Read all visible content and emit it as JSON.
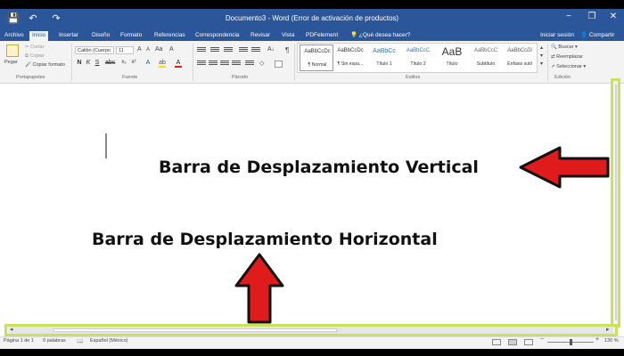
{
  "quick_access": [
    "💾",
    "↶",
    "↷"
  ],
  "window": {
    "title": "Documento3 - Word (Error de activación de productos)",
    "minimize": "−",
    "restore": "❐",
    "close": "✕"
  },
  "tabs": [
    "Archivo",
    "Inicio",
    "Insertar",
    "Diseño",
    "Formato",
    "Referencias",
    "Correspondencia",
    "Revisar",
    "Vista",
    "PDFelement"
  ],
  "active_tab": "Inicio",
  "tell_me": "¿Qué desea hacer?",
  "sign_in": "Iniciar sesión",
  "share": "Compartir",
  "ribbon": {
    "clipboard": {
      "paste": "Pegar",
      "cut": "Cortar",
      "copy": "Copiar",
      "format_painter": "Copiar formato",
      "label": "Portapapeles"
    },
    "font": {
      "name": "Calibri (Cuerpo",
      "size": "11",
      "label": "Fuente"
    },
    "paragraph": {
      "label": "Párrafo"
    },
    "styles": {
      "label": "Estilos",
      "items": [
        {
          "sample": "AaBbCcDc",
          "name": "¶ Normal"
        },
        {
          "sample": "AaBbCcDc",
          "name": "¶ Sin espa..."
        },
        {
          "sample": "AaBbCc",
          "name": "Título 1"
        },
        {
          "sample": "AaBbCcC",
          "name": "Título 2"
        },
        {
          "sample": "AaB",
          "name": "Título"
        },
        {
          "sample": "AaBbCcC",
          "name": "Subtítulo"
        },
        {
          "sample": "AaBbCcDi",
          "name": "Énfasis sutil"
        }
      ]
    },
    "editing": {
      "find": "Buscar",
      "replace": "Reemplazar",
      "select": "Seleccionar",
      "label": "Edición"
    }
  },
  "annotations": {
    "vertical": "Barra de Desplazamiento Vertical",
    "horizontal": "Barra de Desplazamiento Horizontal",
    "arrow_color": "#e01b1b",
    "highlight_color": "#c8e25a"
  },
  "status": {
    "page": "Página 1 de 1",
    "words": "0 palabras",
    "language": "Español (México)",
    "zoom": "130 %",
    "zoom_minus": "−",
    "zoom_plus": "+"
  }
}
